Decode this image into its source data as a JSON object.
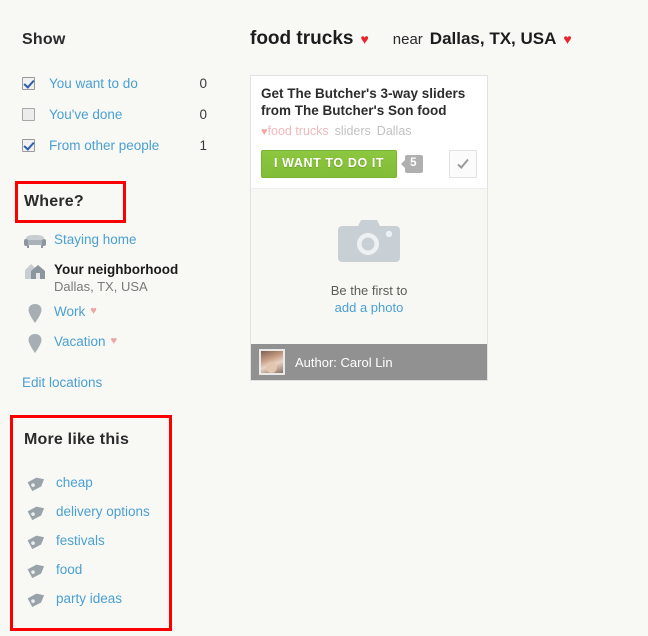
{
  "header": {
    "query": "food trucks",
    "query_heart": "♥",
    "near_label": "near",
    "place": "Dallas, TX, USA",
    "place_heart": "♥",
    "accent_heart_color": "#e8262c"
  },
  "sidebar": {
    "show": {
      "title": "Show",
      "rows": [
        {
          "label": "You want to do",
          "count": "0",
          "checked": true
        },
        {
          "label": "You've done",
          "count": "0",
          "checked": false
        },
        {
          "label": "From other people",
          "count": "1",
          "checked": true
        }
      ]
    },
    "where": {
      "title": "Where?",
      "items": [
        {
          "icon": "sofa-icon",
          "label": "Staying home",
          "sub": "",
          "heart": "",
          "strong": false
        },
        {
          "icon": "house-icon",
          "label": "Your neighborhood",
          "sub": "Dallas, TX, USA",
          "heart": "",
          "strong": true
        },
        {
          "icon": "map-pin-icon",
          "label": "Work",
          "sub": "",
          "heart": "♥",
          "strong": false
        },
        {
          "icon": "map-pin-icon",
          "label": "Vacation",
          "sub": "",
          "heart": "♥",
          "strong": false
        }
      ],
      "edit_link": "Edit locations"
    },
    "more_like_this": {
      "title": "More like this",
      "tags": [
        {
          "icon": "tag-icon",
          "label": "cheap"
        },
        {
          "icon": "tag-icon",
          "label": "delivery options"
        },
        {
          "icon": "tag-icon",
          "label": "festivals"
        },
        {
          "icon": "tag-icon",
          "label": "food"
        },
        {
          "icon": "tag-icon",
          "label": "party ideas"
        }
      ]
    }
  },
  "card": {
    "title": "Get The Butcher's 3-way sliders from The Butcher's Son food",
    "tag_heart": "♥",
    "tag_primary": "food trucks",
    "tag_secondary": [
      "sliders",
      "Dallas"
    ],
    "want_button": "I WANT TO DO IT",
    "want_count_badge": "5",
    "done_button_icon": "✓",
    "photo_prompt": "Be the first to",
    "photo_link": "add a photo",
    "author_prefix": "Author:",
    "author_name": "Carol Lin",
    "author_full": "Author: Carol Lin",
    "button_color": "#8dc63f",
    "author_bar_color": "#919191"
  },
  "annotations": {
    "highlight_color": "#fc0000",
    "boxes": [
      "Where?",
      "More like this"
    ]
  }
}
